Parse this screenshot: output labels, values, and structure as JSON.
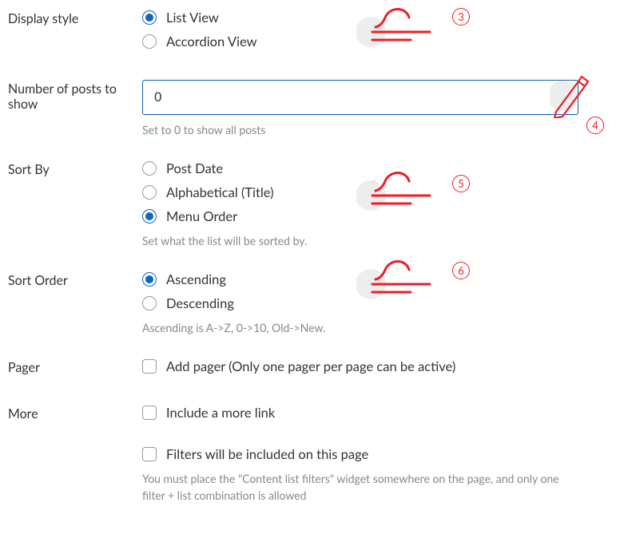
{
  "displayStyle": {
    "label": "Display style",
    "options": {
      "list": "List View",
      "accordion": "Accordion View"
    }
  },
  "numPosts": {
    "label": "Number of posts to show",
    "value": "0",
    "help": "Set to 0 to show all posts"
  },
  "sortBy": {
    "label": "Sort By",
    "options": {
      "postDate": "Post Date",
      "alpha": "Alphabetical (Title)",
      "menuOrder": "Menu Order"
    },
    "help": "Set what the list will be sorted by."
  },
  "sortOrder": {
    "label": "Sort Order",
    "options": {
      "asc": "Ascending",
      "desc": "Descending"
    },
    "help": "Ascending is A->Z, 0->10, Old->New."
  },
  "pager": {
    "label": "Pager",
    "option": "Add pager (Only one pager per page can be active)"
  },
  "more": {
    "label": "More",
    "option": "Include a more link"
  },
  "filters": {
    "option": "Filters will be included on this page",
    "help": "You must place the \"Content list filters\" widget somewhere on the page, and only one filter + list combination is allowed"
  },
  "annotations": {
    "b3": "3",
    "b4": "4",
    "b5": "5",
    "b6": "6"
  }
}
